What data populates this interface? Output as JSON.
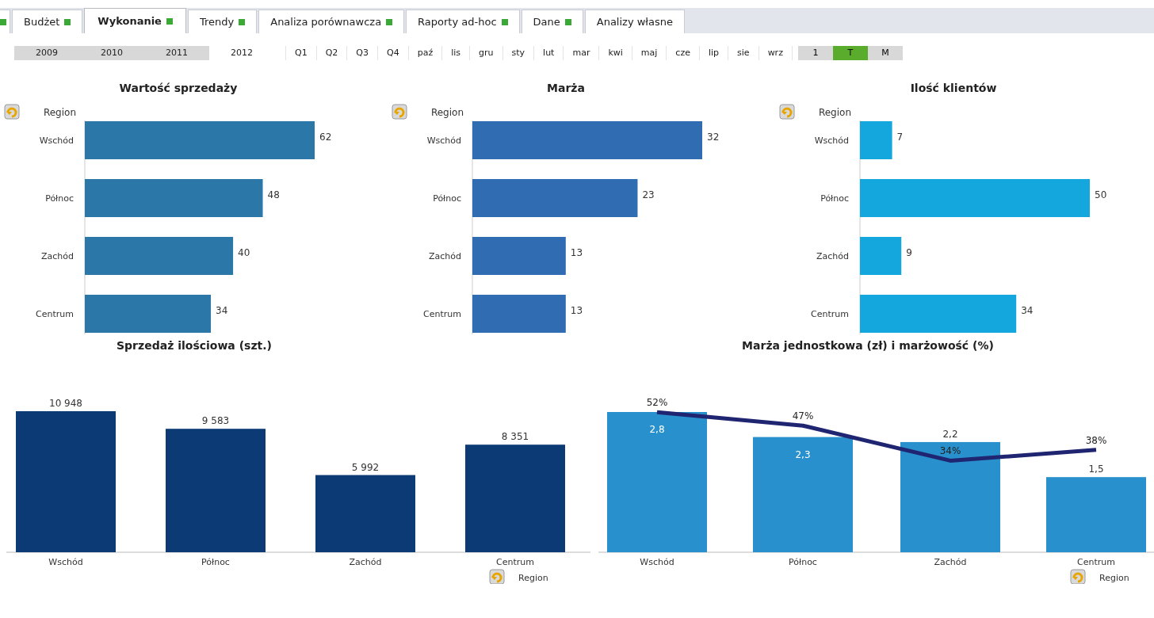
{
  "tabs": [
    {
      "indicator": true,
      "selected": false
    },
    {
      "label": "Budżet",
      "indicator": true,
      "selected": false
    },
    {
      "label": "Wykonanie",
      "indicator": true,
      "selected": true
    },
    {
      "label": "Trendy",
      "indicator": true,
      "selected": false
    },
    {
      "label": "Analiza porównawcza",
      "indicator": true,
      "selected": false
    },
    {
      "label": "Raporty ad-hoc",
      "indicator": true,
      "selected": false
    },
    {
      "label": "Dane",
      "indicator": true,
      "selected": false
    },
    {
      "label": "Analizy własne",
      "indicator": false,
      "selected": false
    }
  ],
  "years": [
    {
      "label": "2009",
      "greyed": true
    },
    {
      "label": "2010",
      "greyed": true
    },
    {
      "label": "2011",
      "greyed": true
    },
    {
      "label": "2012",
      "greyed": false
    }
  ],
  "quarters": [
    "Q1",
    "Q2",
    "Q3",
    "Q4"
  ],
  "months": [
    "paź",
    "lis",
    "gru",
    "sty",
    "lut",
    "mar",
    "kwi",
    "maj",
    "cze",
    "lip",
    "sie",
    "wrz"
  ],
  "scale_buttons": [
    {
      "label": "1",
      "selected": false
    },
    {
      "label": "T",
      "selected": true
    },
    {
      "label": "M",
      "selected": false
    }
  ],
  "top_charts": [
    {
      "dimension_label": "Region",
      "chart_data": {
        "type": "bar",
        "orientation": "horizontal",
        "title": "Wartość sprzedaży",
        "categories": [
          "Wschód",
          "Północ",
          "Zachód",
          "Centrum"
        ],
        "series": [
          {
            "color": "#2a77a8",
            "values": [
              62,
              48,
              40,
              34
            ]
          }
        ],
        "data_labels": true
      }
    },
    {
      "dimension_label": "Region",
      "chart_data": {
        "type": "bar",
        "orientation": "horizontal",
        "title": "Marża",
        "categories": [
          "Wschód",
          "Północ",
          "Zachód",
          "Centrum"
        ],
        "series": [
          {
            "color": "#2f6cb2",
            "values": [
              32,
              23,
              13,
              13
            ]
          }
        ],
        "data_labels": true
      }
    },
    {
      "dimension_label": "Region",
      "chart_data": {
        "type": "bar",
        "orientation": "horizontal",
        "title": "Ilość klientów",
        "categories": [
          "Wschód",
          "Północ",
          "Zachód",
          "Centrum"
        ],
        "series": [
          {
            "color": "#14a7dd",
            "values": [
              7,
              50,
              9,
              34
            ]
          }
        ],
        "data_labels": true
      }
    }
  ],
  "bottom_charts": [
    {
      "dimension_label": "Region",
      "chart_data": {
        "type": "bar",
        "title": "Sprzedaż ilościowa (szt.)",
        "categories": [
          "Wschód",
          "Północ",
          "Zachód",
          "Centrum"
        ],
        "series": [
          {
            "type": "bar",
            "color": "#0b3a74",
            "values": [
              10948,
              9583,
              5992,
              8351
            ],
            "value_labels": [
              "10 948",
              "9 583",
              "5 992",
              "8 351"
            ]
          }
        ]
      }
    },
    {
      "dimension_label": "Region",
      "chart_data": {
        "type": "bar",
        "title": "Marża jednostkowa (zł) i marżowość (%)",
        "categories": [
          "Wschód",
          "Północ",
          "Zachód",
          "Centrum"
        ],
        "series": [
          {
            "type": "bar",
            "color": "#2890cc",
            "values": [
              2.8,
              2.3,
              2.2,
              1.5
            ],
            "value_labels": [
              "2,8",
              "2,3",
              "2,2",
              "1,5"
            ]
          }
        ]
      },
      "overlay": {
        "chart_data": {
          "type": "line",
          "series": [
            {
              "color": "#1f2570",
              "values": [
                52,
                47,
                34,
                38
              ],
              "value_labels": [
                "52%",
                "47%",
                "34%",
                "38%"
              ]
            }
          ]
        }
      }
    }
  ]
}
